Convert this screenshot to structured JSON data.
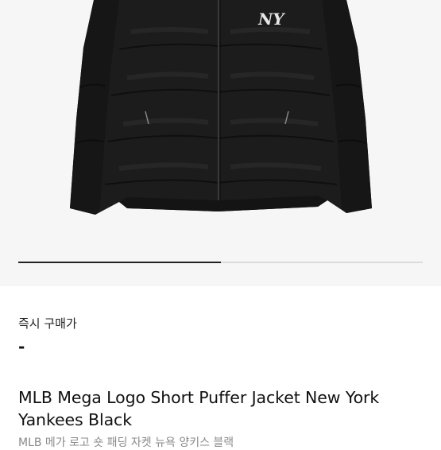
{
  "product": {
    "image_alt": "Black puffer jacket with NY logo",
    "logo_text": "NY",
    "gallery_progress": 0.5,
    "price_label": "즉시 구매가",
    "price_value": "-",
    "title": "MLB Mega Logo Short Puffer Jacket New York Yankees Black",
    "subtitle": "MLB 메가 로고 숏 패딩 자켓 뉴욕 양키스 블랙"
  },
  "colors": {
    "jacket": "#1b1b1b",
    "background": "#f6f6f6",
    "progress": "#222222"
  }
}
